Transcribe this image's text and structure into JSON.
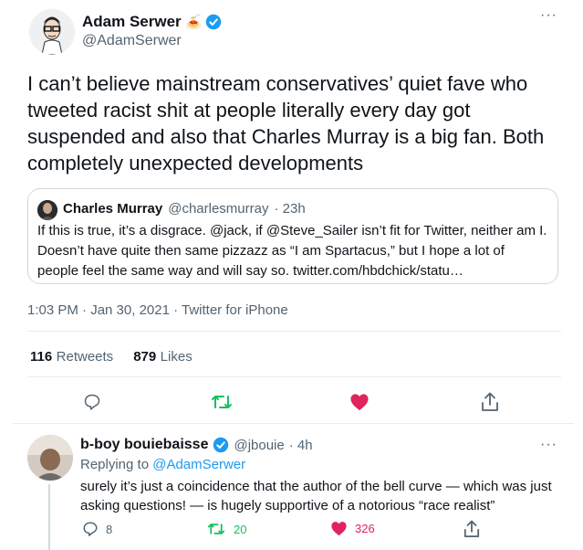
{
  "tweet": {
    "author_name": "Adam Serwer",
    "author_emoji": "🍝",
    "author_handle": "@AdamSerwer",
    "text": "I can’t believe mainstream conservatives’ quiet fave who tweeted racist shit at people literally every day got suspended and also that Charles Murray is a big fan. Both completely unexpected developments",
    "timestamp": "1:03 PM · Jan 30, 2021 · ",
    "source": "Twitter for iPhone",
    "retweets": "116",
    "retweets_label": "Retweets",
    "likes": "879",
    "likes_label": "Likes"
  },
  "quote": {
    "author_name": "Charles Murray",
    "author_handle": "@charlesmurray",
    "time": "· 23h",
    "text": "If this is true, it’s a disgrace. @jack, if @Steve_Sailer isn’t fit for Twitter, neither am I. Doesn’t have quite then same pizzazz as “I am Spartacus,” but I hope a lot of people feel the same way and will say so. twitter.com/hbdchick/statu…"
  },
  "reply": {
    "author_name": "b-boy bouiebaisse",
    "author_handle": "@jbouie",
    "time": "· 4h",
    "replying_to_prefix": "Replying to ",
    "replying_to_handle": "@AdamSerwer",
    "text": "surely it’s just a coincidence that the author of the bell curve — which was just asking questions! — is hugely supportive of a notorious “race realist”",
    "reply_count": "8",
    "retweet_count": "20",
    "like_count": "326"
  },
  "colors": {
    "accent": "#1d9bf0",
    "retweet_green": "#17bf63",
    "like_red": "#e0245e",
    "secondary_text": "#536471"
  },
  "icons": {
    "more": "more-icon",
    "verified": "verified-badge-icon",
    "reply": "reply-icon",
    "retweet": "retweet-icon",
    "like": "heart-icon",
    "share": "share-icon"
  },
  "more_glyph": "···"
}
